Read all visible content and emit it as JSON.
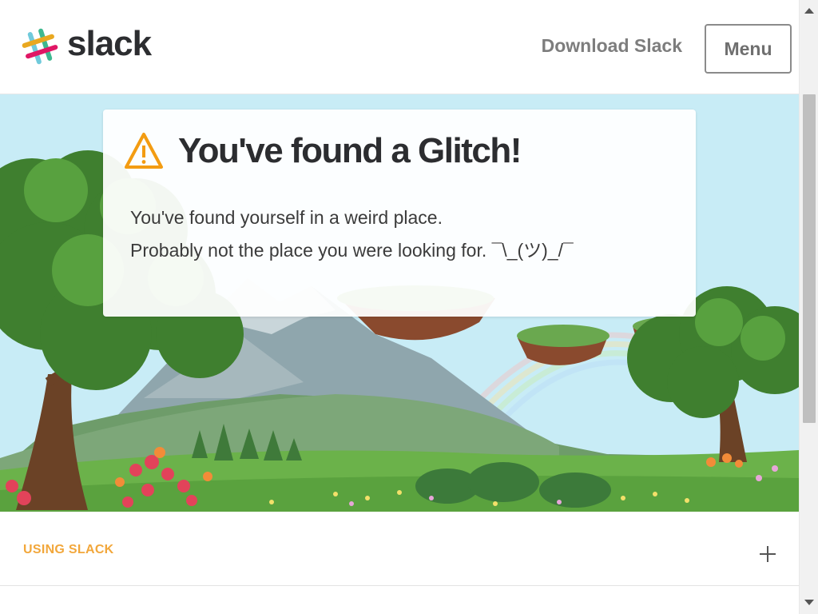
{
  "header": {
    "logo_text": "slack",
    "download_label": "Download Slack",
    "menu_label": "Menu"
  },
  "glitch": {
    "title": "You've found a Glitch!",
    "line1": "You've found yourself in a weird place.",
    "line2": "Probably not the place you were looking for. ¯\\_(ツ)_/¯"
  },
  "footer": {
    "section_label": "USING SLACK"
  },
  "icons": {
    "logo": "slack-hash-icon",
    "warning": "warning-triangle-icon",
    "expand": "plus-icon"
  },
  "colors": {
    "accent_orange": "#f2a73b",
    "text_dark": "#2c2d30",
    "warning_orange": "#f39c12"
  }
}
